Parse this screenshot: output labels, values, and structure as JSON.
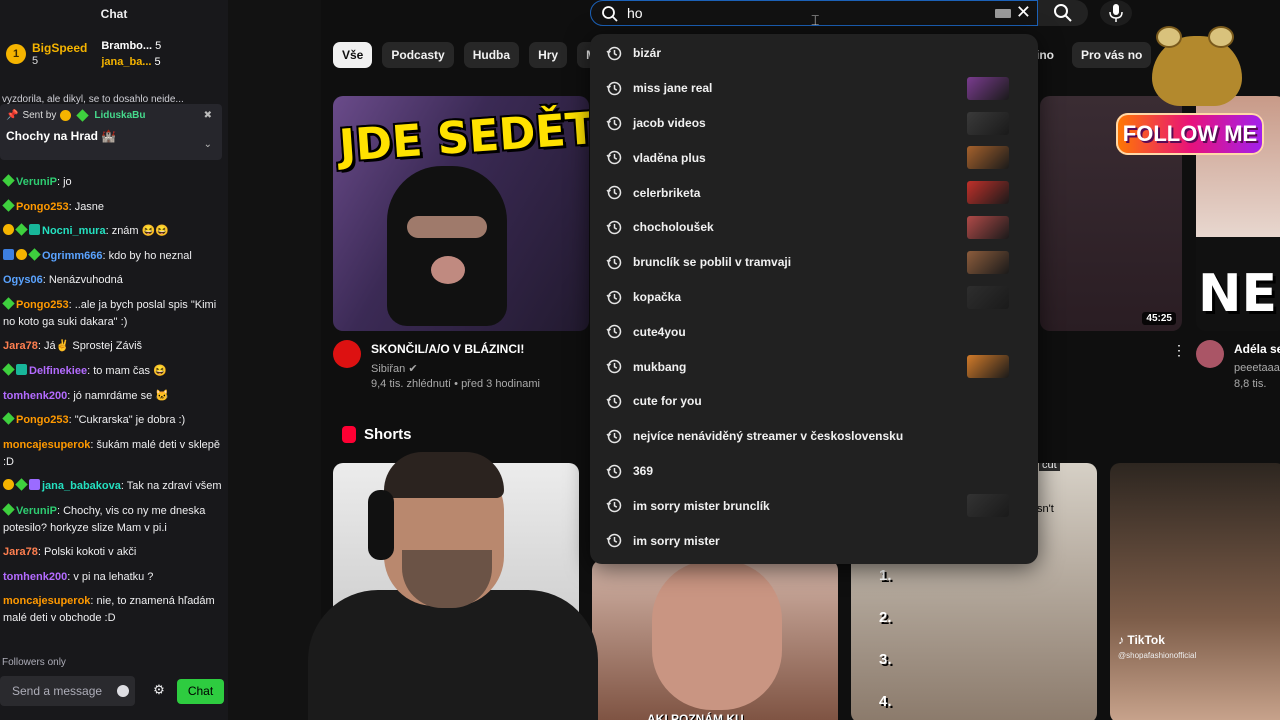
{
  "chat": {
    "header": "Chat",
    "leaderboard": {
      "first_rank": "1",
      "first_name": "BigSpeed",
      "first_count": "5",
      "second_name": "Brambo...",
      "second_count": "5",
      "third_name": "jana_ba...",
      "third_count": "5"
    },
    "pinned_label": "Sent by",
    "pinned_rank": "1",
    "pinned_sender": "LiduskaBu",
    "pinned_message": "Chochy na Hrad 🏰",
    "scrolled_text": "vyzdorila, ale dikyl, se to dosahlo neide...",
    "messages": [
      {
        "user": "VeruniP",
        "color": "#2ecc71",
        "text": ": jo",
        "badges": [
          "green"
        ]
      },
      {
        "user": "Pongo253",
        "color": "#ff9900",
        "text": ": Jasne",
        "badges": [
          "green"
        ]
      },
      {
        "user": "Nocni_mura",
        "color": "#24e0c0",
        "text": ": znám 😆😆",
        "badges": [
          "gold",
          "green",
          "teal"
        ]
      },
      {
        "user": "Ogrimm666",
        "color": "#5aa3ff",
        "text": ": kdo by ho neznal",
        "badges": [
          "blue",
          "gold",
          "green"
        ]
      },
      {
        "user": "Ogys06",
        "color": "#5aa3ff",
        "text": ": Nenázvuhodná",
        "badges": []
      },
      {
        "user": "Pongo253",
        "color": "#ff9900",
        "text": ": ..ale ja bych poslal spis \"Kimi no koto ga suki dakara\" :)",
        "badges": [
          "green"
        ]
      },
      {
        "user": "Jara78",
        "color": "#ff7f50",
        "text": ": Já✌ Sprostej Záviš",
        "badges": []
      },
      {
        "user": "Delfinekiee",
        "color": "#b36bff",
        "text": ": to mam čas 😆",
        "badges": [
          "green",
          "teal"
        ]
      },
      {
        "user": "tomhenk200",
        "color": "#b36bff",
        "text": ": jó namrdáme se 🐱",
        "badges": []
      },
      {
        "user": "Pongo253",
        "color": "#ff9900",
        "text": ": \"Cukrarska\" je dobra :)",
        "badges": [
          "green"
        ]
      },
      {
        "user": "moncajesuperok",
        "color": "#ff9900",
        "text": ": šukám malé deti v sklepě :D",
        "badges": []
      },
      {
        "user": "jana_babakova",
        "color": "#24e0c0",
        "text": ": Tak na zdraví všem",
        "badges": [
          "gold",
          "green",
          "purple"
        ]
      },
      {
        "user": "VeruniP",
        "color": "#2ecc71",
        "text": ": Chochy, vis co ny me dneska potesilo? horkyze slize Mam v pi.i",
        "badges": [
          "green"
        ]
      },
      {
        "user": "Jara78",
        "color": "#ff7f50",
        "text": ": Polski kokoti v akči",
        "badges": []
      },
      {
        "user": "tomhenk200",
        "color": "#b36bff",
        "text": ": v pi na lehatku ?",
        "badges": []
      },
      {
        "user": "moncajesuperok",
        "color": "#ff9900",
        "text": ": nie, to znamená hľadám malé deti v obchode :D",
        "badges": []
      }
    ],
    "followers_only": "Followers only",
    "input_placeholder": "Send a message",
    "chat_button": "Chat"
  },
  "youtube": {
    "search_value": "ho",
    "chips": [
      "Vše",
      "Podcasty",
      "Hudba",
      "Hry",
      "Mix"
    ],
    "chips_right": [
      "ino",
      "Pro vás no"
    ],
    "video": {
      "thumb_text": "JDE SEDĚT",
      "title": "SKONČIL/A/O V BLÁZINCI!",
      "channel": "Sibiřan",
      "stats": "9,4 tis. zhlédnutí • před 3 hodinami"
    },
    "video2": {
      "duration": "45:25",
      "title": "Adéla se",
      "channel": "peeetaaa",
      "stats": "8,8 tis."
    },
    "thumb_right_text": "NEM",
    "shorts_title": "Shorts",
    "shorts_overlay": {
      "numbers": [
        "1.",
        "2.",
        "3.",
        "4."
      ],
      "cut_text": "cut",
      "isnt_text": "sn't",
      "tiktok": "TikTok",
      "tiktok_handle": "@shopafashionofficial",
      "caption": "AKI POZNÁM KU..."
    },
    "suggestions": [
      {
        "text": "bizár",
        "thumb": ""
      },
      {
        "text": "miss jane real",
        "thumb": "#7a3c8f"
      },
      {
        "text": "jacob videos",
        "thumb": "#3a3a3a"
      },
      {
        "text": "vladěna plus",
        "thumb": "#a5612c"
      },
      {
        "text": "celerbriketa",
        "thumb": "#c0302a"
      },
      {
        "text": "chocholoušek",
        "thumb": "#b04a48"
      },
      {
        "text": "brunclík se poblil v tramvaji",
        "thumb": "#8c5c3c"
      },
      {
        "text": "kopačka",
        "thumb": "#2e2e2e"
      },
      {
        "text": "cute4you",
        "thumb": ""
      },
      {
        "text": "mukbang",
        "thumb": "#d27b2a"
      },
      {
        "text": "cute for you",
        "thumb": ""
      },
      {
        "text": "nejvíce nenáviděný streamer v československu",
        "thumb": ""
      },
      {
        "text": "369",
        "thumb": ""
      },
      {
        "text": "im sorry mister brunclík",
        "thumb": "#333333"
      },
      {
        "text": "im sorry mister",
        "thumb": ""
      }
    ]
  },
  "overlay": {
    "follow_me": "FOLLOW ME"
  },
  "colors": {
    "twitch_bg": "#18181b",
    "youtube_bg": "#0f0f0f",
    "dropdown_bg": "#212121",
    "chat_button": "#2ecc40",
    "gold_badge": "#f5b400"
  },
  "icons": [
    "search-icon",
    "clear-icon",
    "keyboard-icon",
    "mic-icon",
    "history-icon",
    "gear-icon",
    "emoji-icon",
    "shorts-icon",
    "kebab-icon",
    "pin-icon",
    "chevron-down-icon",
    "hide-icon"
  ]
}
